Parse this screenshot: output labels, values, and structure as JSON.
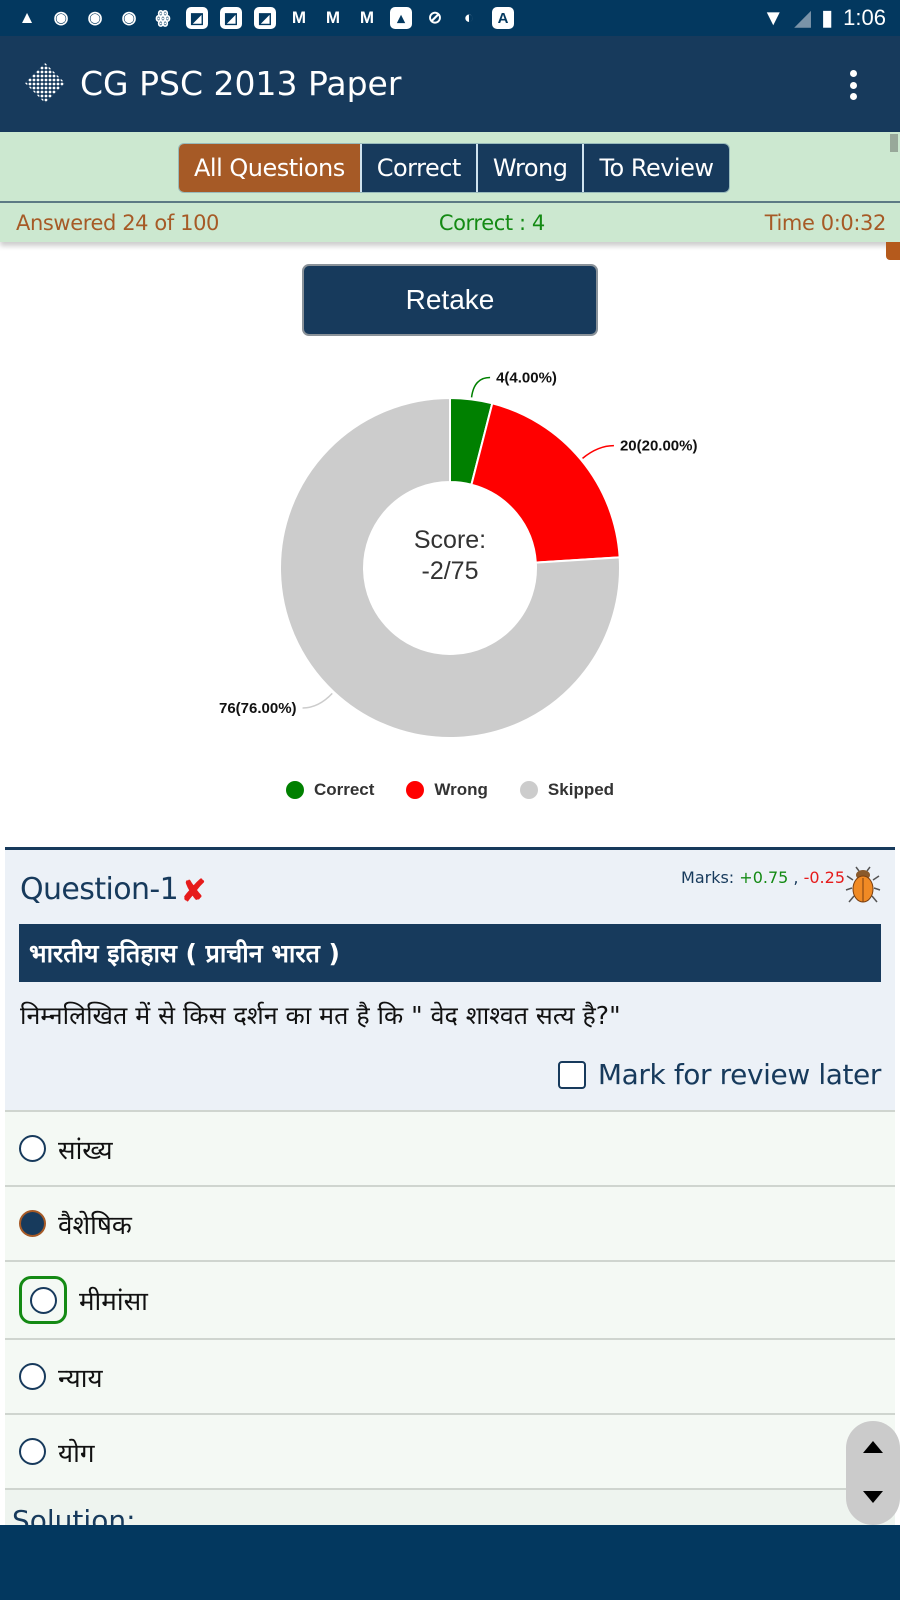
{
  "status_bar": {
    "notification_icons": [
      "android-icon",
      "chrome-icon",
      "chrome-icon",
      "chrome-icon",
      "butterfly-icon",
      "app-square-icon",
      "app-square-icon",
      "app-square-icon",
      "gmail-icon",
      "gmail-icon",
      "gmail-icon",
      "image-icon",
      "stripe-icon",
      "circle-app-icon",
      "font-a-icon"
    ],
    "time": "1:06"
  },
  "app_bar": {
    "title": "CG PSC 2013 Paper"
  },
  "filter": {
    "tabs": [
      {
        "label": "All Questions",
        "active": true
      },
      {
        "label": "Correct",
        "active": false
      },
      {
        "label": "Wrong",
        "active": false
      },
      {
        "label": "To Review",
        "active": false
      }
    ],
    "answered": "Answered 24 of 100",
    "correct": "Correct : 4",
    "time": "Time 0:0:32"
  },
  "retake_label": "Retake",
  "chart_data": {
    "type": "pie",
    "variant": "donut",
    "center_text": [
      "Score:",
      "-2/75"
    ],
    "categories": [
      "Correct",
      "Wrong",
      "Skipped"
    ],
    "values": [
      4,
      20,
      76
    ],
    "percentages": [
      4.0,
      20.0,
      76.0
    ],
    "data_labels": [
      "4(4.00%)",
      "20(20.00%)",
      "76(76.00%)"
    ],
    "colors": [
      "#008000",
      "#ff0000",
      "#cccccc"
    ],
    "legend": "bottom"
  },
  "legend": [
    {
      "label": "Correct",
      "color": "#008000"
    },
    {
      "label": "Wrong",
      "color": "#ff0000"
    },
    {
      "label": "Skipped",
      "color": "#cccccc"
    }
  ],
  "question": {
    "title": "Question-1",
    "result_icon": "✘",
    "marks_label": "Marks:",
    "marks_positive": "+0.75",
    "marks_sep": " , ",
    "marks_negative": "-0.25",
    "subject": "भारतीय इतिहास ( प्राचीन भारत )",
    "text": "निम्नलिखित में से किस दर्शन का मत है कि \" वेद शाश्वत सत्य है?\"",
    "review_label": "Mark for review later",
    "review_checked": false,
    "options": [
      {
        "label": "सांख्य",
        "state": "unselected"
      },
      {
        "label": "वैशेषिक",
        "state": "selected"
      },
      {
        "label": "मीमांसा",
        "state": "correct"
      },
      {
        "label": "न्याय",
        "state": "unselected"
      },
      {
        "label": "योग",
        "state": "unselected"
      }
    ],
    "solution_label": "Solution:"
  }
}
